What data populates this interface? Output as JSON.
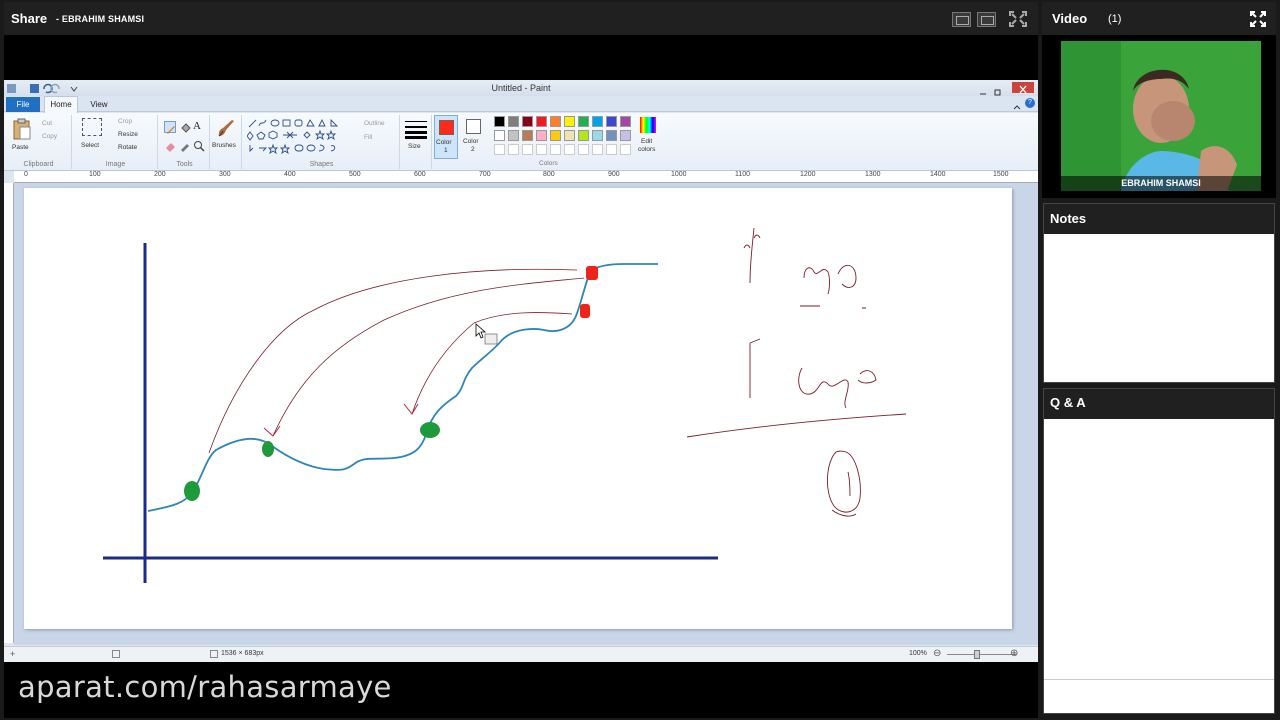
{
  "share": {
    "title": "Share",
    "presenter": "- EBRAHIM SHAMSI"
  },
  "paint": {
    "window_title": "Untitled - Paint",
    "tabs": {
      "file": "File",
      "home": "Home",
      "view": "View"
    },
    "ribbon": {
      "clipboard": {
        "paste": "Paste",
        "cut": "Cut",
        "copy": "Copy",
        "label": "Clipboard"
      },
      "image": {
        "select": "Select",
        "crop": "Crop",
        "resize": "Resize",
        "rotate": "Rotate",
        "label": "Image"
      },
      "tools": {
        "label": "Tools",
        "text_tool": "A"
      },
      "brushes": {
        "label": "Brushes"
      },
      "shapes": {
        "outline": "Outline",
        "fill": "Fill",
        "label": "Shapes"
      },
      "size": {
        "label": "Size"
      },
      "color1": {
        "label": "Color",
        "num": "1"
      },
      "color2": {
        "label": "Color",
        "num": "2"
      },
      "colors": {
        "label": "Colors"
      },
      "edit_colors": {
        "label": "Edit",
        "label2": "colors"
      }
    },
    "ruler_ticks": [
      "0",
      "100",
      "200",
      "300",
      "400",
      "500",
      "600",
      "700",
      "800",
      "900",
      "1000",
      "1100",
      "1200",
      "1300",
      "1400",
      "1500"
    ],
    "status": {
      "dimensions": "1536 × 683px",
      "zoom": "100%"
    },
    "colors": {
      "active_color1": "#ff2a1a",
      "palette_row1": [
        "#000000",
        "#7f7f7f",
        "#880015",
        "#ed1c24",
        "#ff7f27",
        "#fff200",
        "#22b14c",
        "#00a2e8",
        "#3f48cc",
        "#a349a4"
      ],
      "palette_row2": [
        "#ffffff",
        "#c3c3c3",
        "#b97a57",
        "#ffaec9",
        "#ffc90e",
        "#efe4b0",
        "#b5e61d",
        "#99d9ea",
        "#7092be",
        "#c8bfe7"
      ]
    }
  },
  "watermark": "aparat.com/rahasarmaye",
  "video": {
    "title": "Video",
    "count": "(1)",
    "participant": "EBRAHIM SHAMSI"
  },
  "notes": {
    "title": "Notes"
  },
  "qa": {
    "title": "Q & A"
  }
}
